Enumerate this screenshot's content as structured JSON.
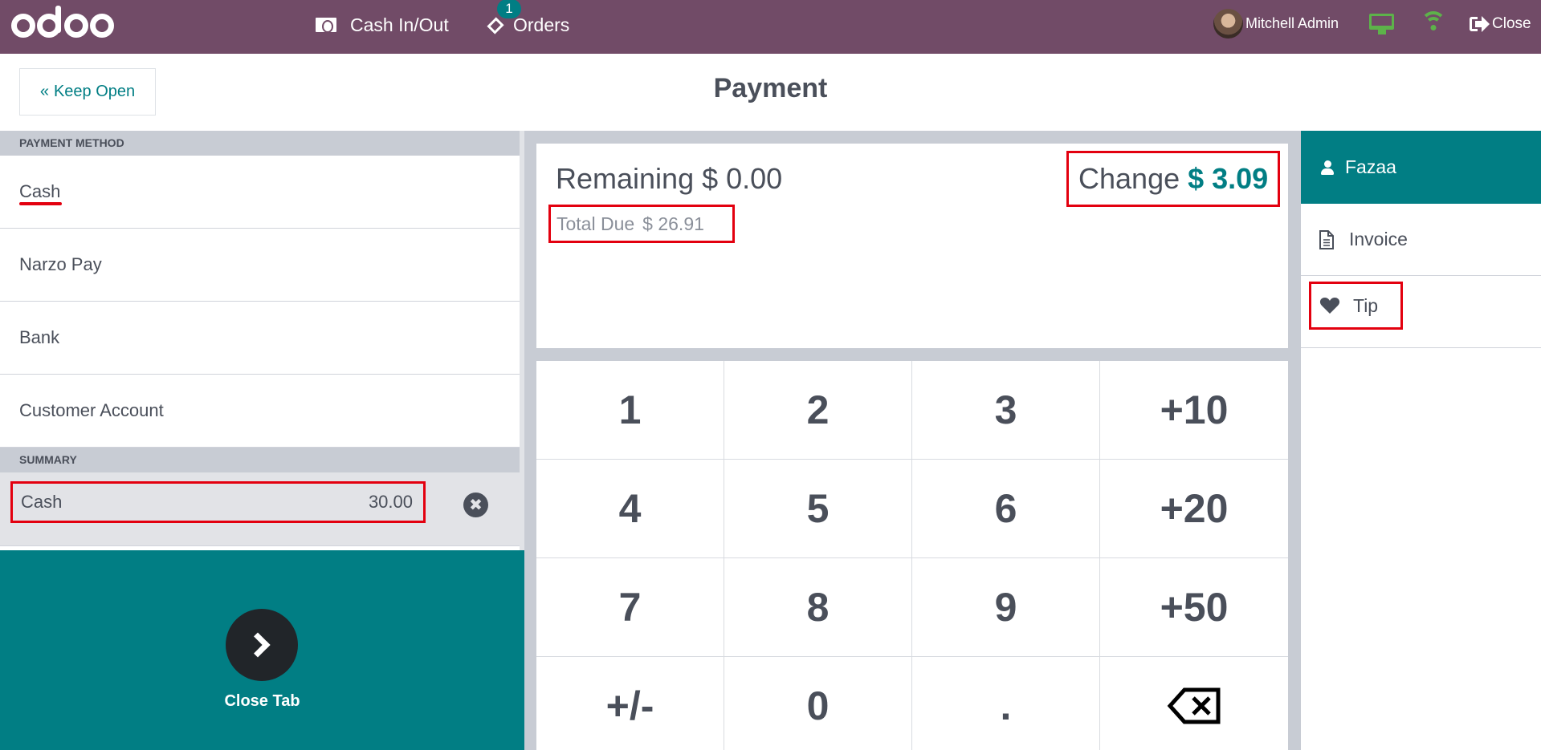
{
  "navbar": {
    "logo": "odoo",
    "cash_in_out": "Cash In/Out",
    "orders": "Orders",
    "orders_badge": "1",
    "user_name": "Mitchell Admin",
    "close": "Close",
    "icons": {
      "cash": "money-bill-icon",
      "orders": "ticket-icon",
      "monitor": "desktop-icon",
      "wifi": "wifi-icon",
      "close": "sign-out-icon"
    },
    "status_color": "#5db24a",
    "background": "#714b67"
  },
  "header": {
    "keep_open": "Keep Open",
    "keep_open_icon": "«",
    "title": "Payment"
  },
  "payment_methods": {
    "section_title": "PAYMENT METHOD",
    "items": [
      {
        "label": "Cash",
        "highlighted": true
      },
      {
        "label": "Narzo Pay"
      },
      {
        "label": "Bank"
      },
      {
        "label": "Customer Account"
      }
    ]
  },
  "summary": {
    "section_title": "SUMMARY",
    "lines": [
      {
        "method": "Cash",
        "amount": "30.00"
      }
    ],
    "remove_icon": "✖"
  },
  "close_tab": {
    "label": "Close Tab",
    "icon": "chevron-right-icon"
  },
  "status": {
    "remaining_label": "Remaining",
    "remaining_value": "$ 0.00",
    "total_due_label": "Total Due",
    "total_due_value": "$ 26.91",
    "change_label": "Change",
    "change_value": "$ 3.09"
  },
  "numpad": {
    "keys": [
      "1",
      "2",
      "3",
      "+10",
      "4",
      "5",
      "6",
      "+20",
      "7",
      "8",
      "9",
      "+50",
      "+/-",
      "0",
      ".",
      "⌫"
    ]
  },
  "right_panel": {
    "customer": "Fazaa",
    "invoice": "Invoice",
    "tip": "Tip"
  },
  "colors": {
    "accent": "#017e84",
    "highlight_box": "#e3000f",
    "text": "#4a4f5a",
    "panel_bg": "#c8ccd4"
  }
}
